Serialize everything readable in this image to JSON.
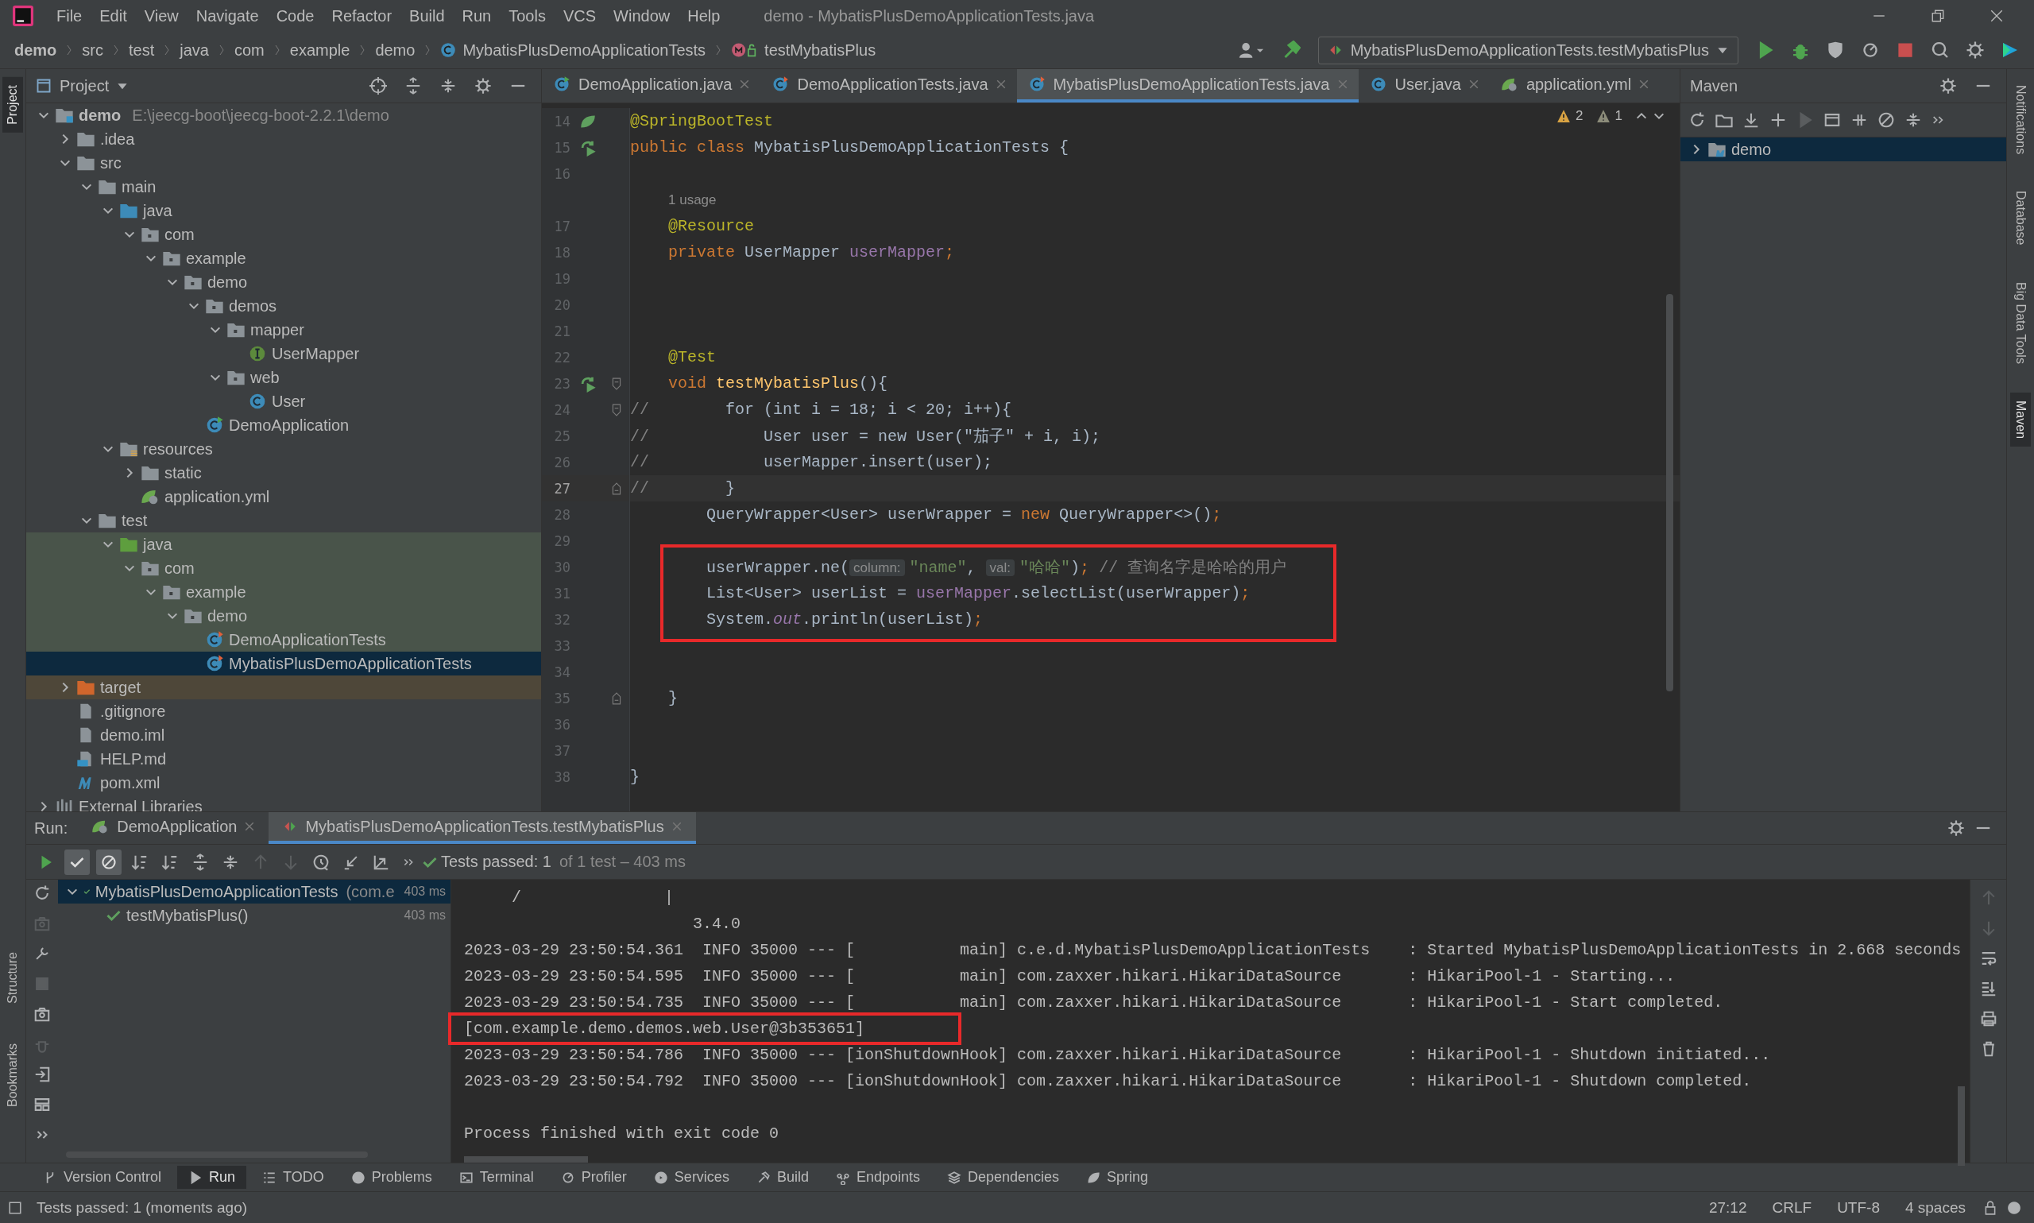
{
  "window": {
    "title": "demo - MybatisPlusDemoApplicationTests.java"
  },
  "menu": [
    "File",
    "Edit",
    "View",
    "Navigate",
    "Code",
    "Refactor",
    "Build",
    "Run",
    "Tools",
    "VCS",
    "Window",
    "Help"
  ],
  "breadcrumb": [
    {
      "label": "demo",
      "kind": "project"
    },
    {
      "label": "src",
      "kind": "dir"
    },
    {
      "label": "test",
      "kind": "dir"
    },
    {
      "label": "java",
      "kind": "dir"
    },
    {
      "label": "com",
      "kind": "dir"
    },
    {
      "label": "example",
      "kind": "dir"
    },
    {
      "label": "demo",
      "kind": "dir"
    },
    {
      "label": "MybatisPlusDemoApplicationTests",
      "kind": "class"
    },
    {
      "label": "testMybatisPlus",
      "kind": "method"
    }
  ],
  "run_config": {
    "label": "MybatisPlusDemoApplicationTests.testMybatisPlus"
  },
  "left_stripe_top": [
    {
      "label": "Project",
      "selected": true
    }
  ],
  "left_stripe_bottom": [
    {
      "label": "Structure",
      "selected": false
    },
    {
      "label": "Bookmarks",
      "selected": false
    }
  ],
  "right_stripe": [
    {
      "label": "Notifications",
      "selected": false
    },
    {
      "label": "Database",
      "selected": false
    },
    {
      "label": "Big Data Tools",
      "selected": false
    },
    {
      "label": "Maven",
      "selected": true
    }
  ],
  "project": {
    "title": "Project",
    "tree": [
      {
        "label": "demo",
        "kind": "module",
        "path": "E:\\jeecg-boot\\jeecg-boot-2.2.1\\demo",
        "expanded": true,
        "selected": false,
        "children": [
          {
            "label": ".idea",
            "kind": "folder",
            "expanded": false,
            "selected": false
          },
          {
            "label": "src",
            "kind": "folder",
            "expanded": true,
            "selected": false,
            "children": [
              {
                "label": "main",
                "kind": "folder",
                "expanded": true,
                "selected": false,
                "children": [
                  {
                    "label": "java",
                    "kind": "source-folder",
                    "expanded": true,
                    "selected": false,
                    "children": [
                      {
                        "label": "com",
                        "kind": "package",
                        "expanded": true,
                        "selected": false,
                        "children": [
                          {
                            "label": "example",
                            "kind": "package",
                            "expanded": true,
                            "selected": false,
                            "children": [
                              {
                                "label": "demo",
                                "kind": "package",
                                "expanded": true,
                                "selected": false,
                                "children": [
                                  {
                                    "label": "demos",
                                    "kind": "package",
                                    "expanded": true,
                                    "selected": false,
                                    "children": [
                                      {
                                        "label": "mapper",
                                        "kind": "package",
                                        "expanded": true,
                                        "selected": false,
                                        "children": [
                                          {
                                            "label": "UserMapper",
                                            "kind": "interface",
                                            "selected": false
                                          }
                                        ]
                                      },
                                      {
                                        "label": "web",
                                        "kind": "package",
                                        "expanded": true,
                                        "selected": false,
                                        "children": [
                                          {
                                            "label": "User",
                                            "kind": "class",
                                            "selected": false
                                          }
                                        ]
                                      }
                                    ]
                                  },
                                  {
                                    "label": "DemoApplication",
                                    "kind": "spring-class",
                                    "selected": false
                                  }
                                ]
                              }
                            ]
                          }
                        ]
                      }
                    ]
                  },
                  {
                    "label": "resources",
                    "kind": "resources-folder",
                    "expanded": true,
                    "selected": false,
                    "children": [
                      {
                        "label": "static",
                        "kind": "folder",
                        "expanded": false,
                        "selected": false
                      },
                      {
                        "label": "application.yml",
                        "kind": "yml",
                        "selected": false
                      }
                    ]
                  }
                ]
              },
              {
                "label": "test",
                "kind": "folder",
                "expanded": true,
                "selected": false,
                "children": [
                  {
                    "label": "java",
                    "kind": "test-folder",
                    "test_source": true,
                    "expanded": true,
                    "selected": false,
                    "children": [
                      {
                        "label": "com",
                        "kind": "package",
                        "test_source": true,
                        "expanded": true,
                        "selected": false,
                        "children": [
                          {
                            "label": "example",
                            "kind": "package",
                            "test_source": true,
                            "expanded": true,
                            "selected": false,
                            "children": [
                              {
                                "label": "demo",
                                "kind": "package",
                                "test_source": true,
                                "expanded": true,
                                "selected": false,
                                "children": [
                                  {
                                    "label": "DemoApplicationTests",
                                    "kind": "test-class",
                                    "test_source": true,
                                    "selected": false
                                  },
                                  {
                                    "label": "MybatisPlusDemoApplicationTests",
                                    "kind": "test-class",
                                    "test_source": true,
                                    "selected": true
                                  }
                                ]
                              }
                            ]
                          }
                        ]
                      }
                    ]
                  }
                ]
              }
            ]
          },
          {
            "label": "target",
            "kind": "excluded-folder",
            "excluded": true,
            "expanded": false,
            "selected": false
          },
          {
            "label": ".gitignore",
            "kind": "file",
            "selected": false
          },
          {
            "label": "demo.iml",
            "kind": "file",
            "selected": false
          },
          {
            "label": "HELP.md",
            "kind": "md",
            "selected": false
          },
          {
            "label": "pom.xml",
            "kind": "maven",
            "selected": false
          }
        ]
      },
      {
        "label": "External Libraries",
        "kind": "libraries",
        "expanded": false,
        "selected": false
      }
    ]
  },
  "editor": {
    "tabs": [
      {
        "label": "DemoApplication.java",
        "kind": "spring-class",
        "selected": false
      },
      {
        "label": "DemoApplicationTests.java",
        "kind": "test-class",
        "selected": false
      },
      {
        "label": "MybatisPlusDemoApplicationTests.java",
        "kind": "test-class",
        "selected": true
      },
      {
        "label": "User.java",
        "kind": "class",
        "selected": false
      },
      {
        "label": "application.yml",
        "kind": "yml",
        "selected": false
      }
    ],
    "warnings": "2",
    "weak_warnings": "1",
    "lines": [
      {
        "kind": "code",
        "n": "14",
        "current": false,
        "bean_marker": true,
        "tokens": [
          {
            "kind": "ann",
            "text": "@SpringBootTest"
          }
        ]
      },
      {
        "kind": "code",
        "n": "15",
        "current": false,
        "run_marker": true,
        "tokens": [
          {
            "kind": "kw",
            "text": "public class "
          },
          {
            "kind": "plain",
            "text": "MybatisPlusDemoApplicationTests {"
          }
        ]
      },
      {
        "kind": "code",
        "n": "16",
        "current": false
      },
      {
        "kind": "inlay",
        "text": "1 usage"
      },
      {
        "kind": "code",
        "n": "17",
        "current": false,
        "tokens": [
          {
            "kind": "ann",
            "text": "    @Resource"
          }
        ]
      },
      {
        "kind": "code",
        "n": "18",
        "current": false,
        "tokens": [
          {
            "kind": "kw",
            "text": "    private "
          },
          {
            "kind": "plain",
            "text": "UserMapper "
          },
          {
            "kind": "field",
            "text": "userMapper"
          },
          {
            "kind": "kw",
            "text": ";"
          }
        ]
      },
      {
        "kind": "code",
        "n": "19",
        "current": false
      },
      {
        "kind": "code",
        "n": "20",
        "current": false
      },
      {
        "kind": "code",
        "n": "21",
        "current": false
      },
      {
        "kind": "code",
        "n": "22",
        "current": false,
        "tokens": [
          {
            "kind": "ann",
            "text": "    @Test"
          }
        ]
      },
      {
        "kind": "code",
        "n": "23",
        "current": false,
        "run_marker": true,
        "fold_start": true,
        "tokens": [
          {
            "kind": "kw",
            "text": "    void "
          },
          {
            "kind": "method",
            "text": "testMybatisPlus"
          },
          {
            "kind": "plain",
            "text": "(){"
          }
        ]
      },
      {
        "kind": "code",
        "n": "24",
        "current": false,
        "fold_start": true,
        "tokens": [
          {
            "kind": "comment",
            "text": "//"
          },
          {
            "kind": "plain",
            "text": "        for (int i = 18; i < 20; i++){"
          }
        ]
      },
      {
        "kind": "code",
        "n": "25",
        "current": false,
        "tokens": [
          {
            "kind": "comment",
            "text": "//"
          },
          {
            "kind": "plain",
            "text": "            User user = new User(\"茄子\" + i, i);"
          }
        ]
      },
      {
        "kind": "code",
        "n": "26",
        "current": false,
        "tokens": [
          {
            "kind": "comment",
            "text": "//"
          },
          {
            "kind": "plain",
            "text": "            userMapper.insert(user);"
          }
        ]
      },
      {
        "kind": "code",
        "n": "27",
        "current": true,
        "fold_end": true,
        "tokens": [
          {
            "kind": "comment",
            "text": "//"
          },
          {
            "kind": "plain",
            "text": "        }"
          }
        ]
      },
      {
        "kind": "code",
        "n": "28",
        "current": false,
        "tokens": [
          {
            "kind": "plain",
            "text": "        QueryWrapper<User> userWrapper = "
          },
          {
            "kind": "kw",
            "text": "new "
          },
          {
            "kind": "plain",
            "text": "QueryWrapper<>()"
          },
          {
            "kind": "kw",
            "text": ";"
          }
        ]
      },
      {
        "kind": "code",
        "n": "29",
        "current": false
      },
      {
        "kind": "code",
        "n": "30",
        "current": false,
        "boxed": true,
        "tokens": [
          {
            "kind": "plain",
            "text": "        userWrapper.ne("
          },
          {
            "kind": "hint",
            "text": "column:"
          },
          {
            "kind": "str",
            "text": "\"name\""
          },
          {
            "kind": "plain",
            "text": ", "
          },
          {
            "kind": "hint",
            "text": "val:"
          },
          {
            "kind": "str",
            "text": "\"哈哈\""
          },
          {
            "kind": "plain",
            "text": ")"
          },
          {
            "kind": "kw",
            "text": ";"
          },
          {
            "kind": "comment",
            "text": " // 查询名字是哈哈的用户"
          }
        ]
      },
      {
        "kind": "code",
        "n": "31",
        "current": false,
        "boxed": true,
        "tokens": [
          {
            "kind": "plain",
            "text": "        List<User> userList = "
          },
          {
            "kind": "field",
            "text": "userMapper"
          },
          {
            "kind": "plain",
            "text": ".selectList(userWrapper)"
          },
          {
            "kind": "kw",
            "text": ";"
          }
        ]
      },
      {
        "kind": "code",
        "n": "32",
        "current": false,
        "boxed": true,
        "tokens": [
          {
            "kind": "plain",
            "text": "        System."
          },
          {
            "kind": "static",
            "text": "out"
          },
          {
            "kind": "plain",
            "text": ".println(userList)"
          },
          {
            "kind": "kw",
            "text": ";"
          }
        ]
      },
      {
        "kind": "code",
        "n": "33",
        "current": false
      },
      {
        "kind": "code",
        "n": "34",
        "current": false
      },
      {
        "kind": "code",
        "n": "35",
        "current": false,
        "fold_end": true,
        "tokens": [
          {
            "kind": "plain",
            "text": "    }"
          }
        ]
      },
      {
        "kind": "code",
        "n": "36",
        "current": false
      },
      {
        "kind": "code",
        "n": "37",
        "current": false
      },
      {
        "kind": "code",
        "n": "38",
        "current": false,
        "tokens": [
          {
            "kind": "plain",
            "text": "}"
          }
        ]
      }
    ]
  },
  "maven": {
    "title": "Maven",
    "tree": [
      {
        "label": "demo",
        "expanded": false,
        "selected": true
      }
    ]
  },
  "run": {
    "title": "Run:",
    "tabs": [
      {
        "label": "DemoApplication",
        "kind": "spring-class",
        "selected": false
      },
      {
        "label": "MybatisPlusDemoApplicationTests.testMybatisPlus",
        "kind": "test-config",
        "selected": true
      }
    ],
    "status": "Tests passed: 1",
    "status_detail": "of 1 test – 403 ms",
    "tests": [
      {
        "label": "MybatisPlusDemoApplicationTests",
        "hint": "(com.e",
        "time": "403 ms",
        "passed": true,
        "expanded": true,
        "selected": true,
        "children": [
          {
            "label": "testMybatisPlus()",
            "time": "403 ms",
            "passed": true,
            "selected": false
          }
        ]
      }
    ],
    "console": [
      {
        "kind": "log",
        "text": "     /               |",
        "boxed": false
      },
      {
        "kind": "log",
        "text": "                        3.4.0",
        "boxed": false
      },
      {
        "kind": "log",
        "text": "2023-03-29 23:50:54.361  INFO 35000 --- [           main] c.e.d.MybatisPlusDemoApplicationTests    : Started MybatisPlusDemoApplicationTests in 2.668 seconds",
        "boxed": false
      },
      {
        "kind": "log",
        "text": "2023-03-29 23:50:54.595  INFO 35000 --- [           main] com.zaxxer.hikari.HikariDataSource       : HikariPool-1 - Starting...",
        "boxed": false
      },
      {
        "kind": "log",
        "text": "2023-03-29 23:50:54.735  INFO 35000 --- [           main] com.zaxxer.hikari.HikariDataSource       : HikariPool-1 - Start completed.",
        "boxed": false
      },
      {
        "kind": "log",
        "text": "[com.example.demo.demos.web.User@3b353651]",
        "boxed": true
      },
      {
        "kind": "log",
        "text": "2023-03-29 23:50:54.786  INFO 35000 --- [ionShutdownHook] com.zaxxer.hikari.HikariDataSource       : HikariPool-1 - Shutdown initiated...",
        "boxed": false
      },
      {
        "kind": "log",
        "text": "2023-03-29 23:50:54.792  INFO 35000 --- [ionShutdownHook] com.zaxxer.hikari.HikariDataSource       : HikariPool-1 - Shutdown completed.",
        "boxed": false
      },
      {
        "kind": "blank"
      },
      {
        "kind": "log",
        "text": "Process finished with exit code 0",
        "boxed": false
      }
    ]
  },
  "tool_windows": [
    {
      "label": "Version Control",
      "kind": "vcs",
      "selected": false
    },
    {
      "label": "Run",
      "kind": "run",
      "selected": true
    },
    {
      "label": "TODO",
      "kind": "todo",
      "selected": false
    },
    {
      "label": "Problems",
      "kind": "problems",
      "selected": false
    },
    {
      "label": "Terminal",
      "kind": "terminal",
      "selected": false
    },
    {
      "label": "Profiler",
      "kind": "profiler",
      "selected": false
    },
    {
      "label": "Services",
      "kind": "services",
      "selected": false
    },
    {
      "label": "Build",
      "kind": "build",
      "selected": false
    },
    {
      "label": "Endpoints",
      "kind": "endpoints",
      "selected": false
    },
    {
      "label": "Dependencies",
      "kind": "dependencies",
      "selected": false
    },
    {
      "label": "Spring",
      "kind": "spring",
      "selected": false
    }
  ],
  "status_bar": {
    "message": "Tests passed: 1 (moments ago)",
    "position": "27:12",
    "line_ending": "CRLF",
    "encoding": "UTF-8",
    "indent": "4 spaces"
  }
}
